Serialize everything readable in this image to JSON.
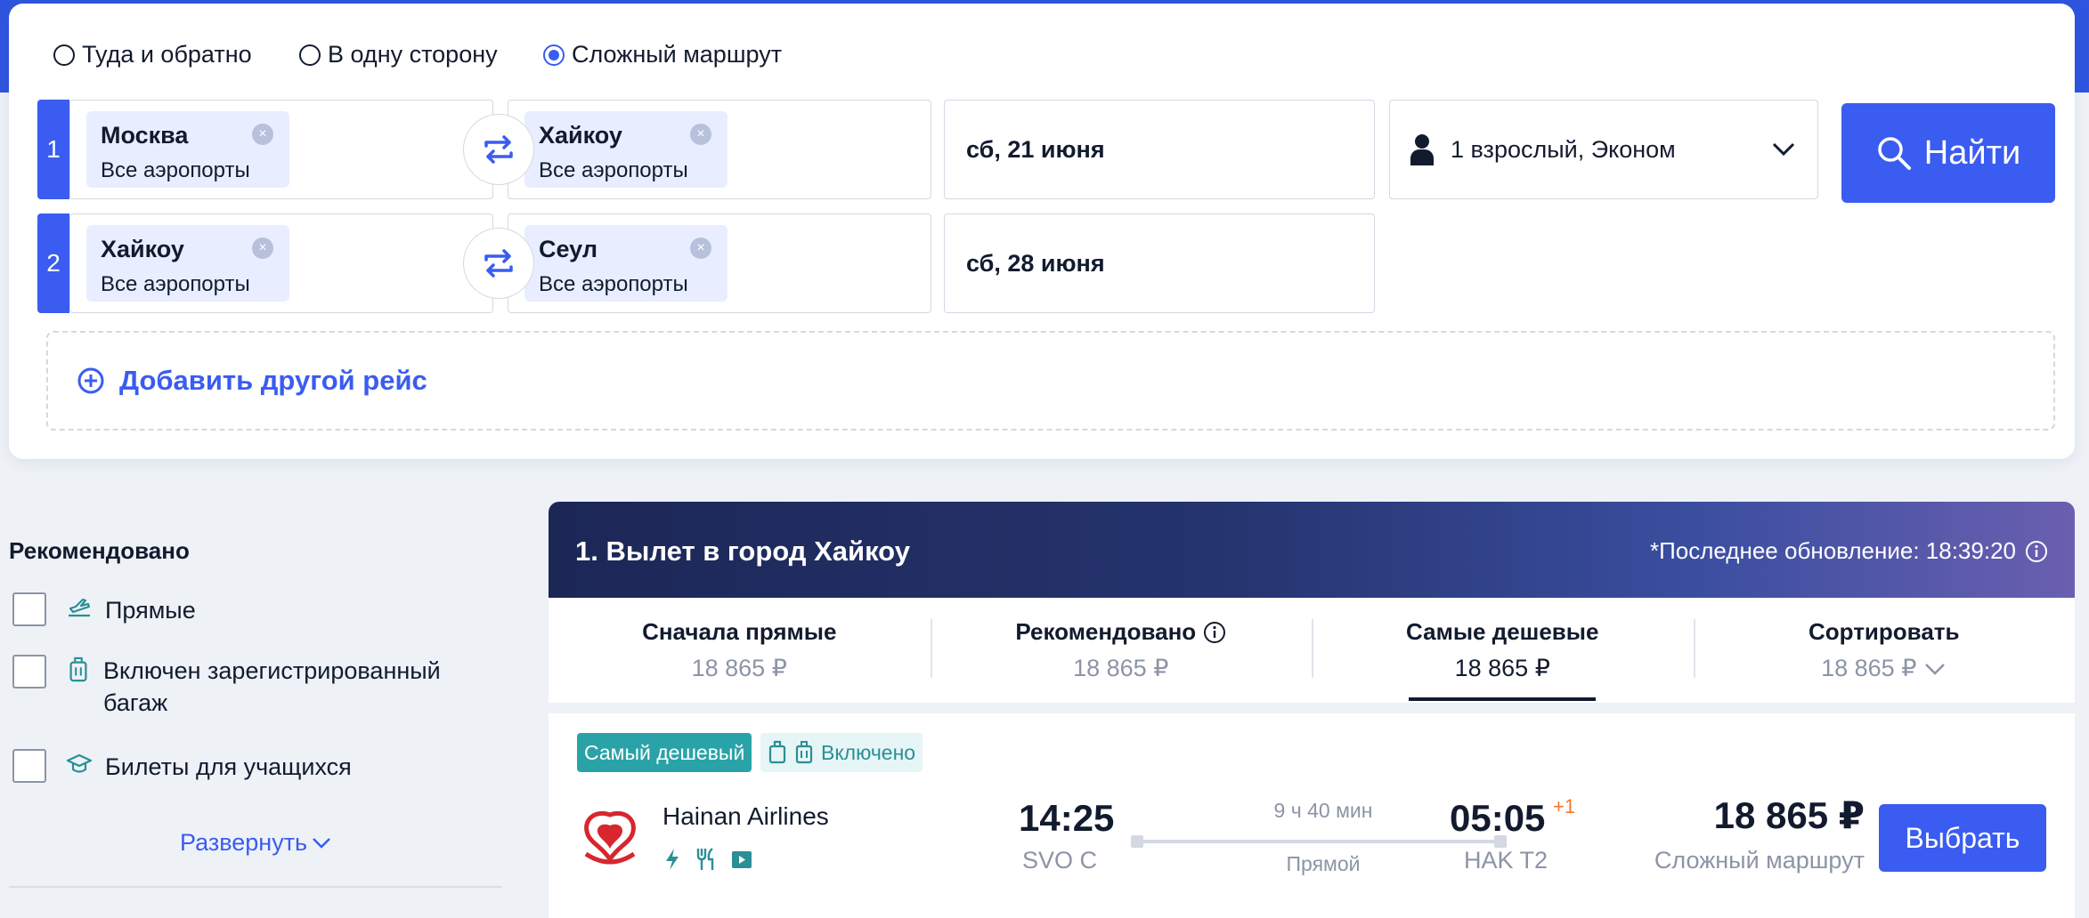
{
  "search": {
    "trip_types": [
      {
        "label": "Туда и обратно",
        "selected": false
      },
      {
        "label": "В одну сторону",
        "selected": false
      },
      {
        "label": "Сложный маршрут",
        "selected": true
      }
    ],
    "legs": [
      {
        "num": "1",
        "from_city": "Москва",
        "from_sub": "Все аэропорты",
        "to_city": "Хайкоу",
        "to_sub": "Все аэропорты",
        "date": "сб, 21 июня"
      },
      {
        "num": "2",
        "from_city": "Хайкоу",
        "from_sub": "Все аэропорты",
        "to_city": "Сеул",
        "to_sub": "Все аэропорты",
        "date": "сб, 28 июня"
      }
    ],
    "passengers": "1 взрослый, Эконом",
    "find_label": "Найти",
    "add_flight_label": "Добавить другой рейс"
  },
  "filters": {
    "heading": "Рекомендовано",
    "items": [
      {
        "label": "Прямые",
        "icon": "plane-takeoff-icon"
      },
      {
        "label": "Включен зарегистрированный багаж",
        "icon": "luggage-icon"
      },
      {
        "label": "Билеты для учащихся",
        "icon": "graduation-cap-icon"
      }
    ],
    "expand_label": "Развернуть"
  },
  "results": {
    "title": "1. Вылет в город Хайкоу",
    "last_update": "*Последнее обновление: 18:39:20",
    "sort_tabs": [
      {
        "label": "Сначала прямые",
        "price": "18 865 ₽"
      },
      {
        "label": "Рекомендовано",
        "price": "18 865 ₽"
      },
      {
        "label": "Самые дешевые",
        "price": "18 865 ₽",
        "active": true
      },
      {
        "label": "Сортировать",
        "price": "18 865 ₽"
      }
    ],
    "flight": {
      "tag_cheapest": "Самый дешевый",
      "tag_baggage": "Включено",
      "airline": "Hainan Airlines",
      "dep_time": "14:25",
      "dep_airport": "SVO C",
      "duration": "9 ч 40 мин",
      "stops": "Прямой",
      "arr_time": "05:05",
      "day_offset": "+1",
      "arr_airport": "HAK T2",
      "price": "18 865 ₽",
      "price_type": "Сложный маршрут",
      "select_label": "Выбрать"
    }
  },
  "colors": {
    "accent": "#3a5cf0",
    "topbar": "#2f55e0",
    "tag_teal": "#2aa3a8",
    "logo_red": "#d7262e"
  }
}
